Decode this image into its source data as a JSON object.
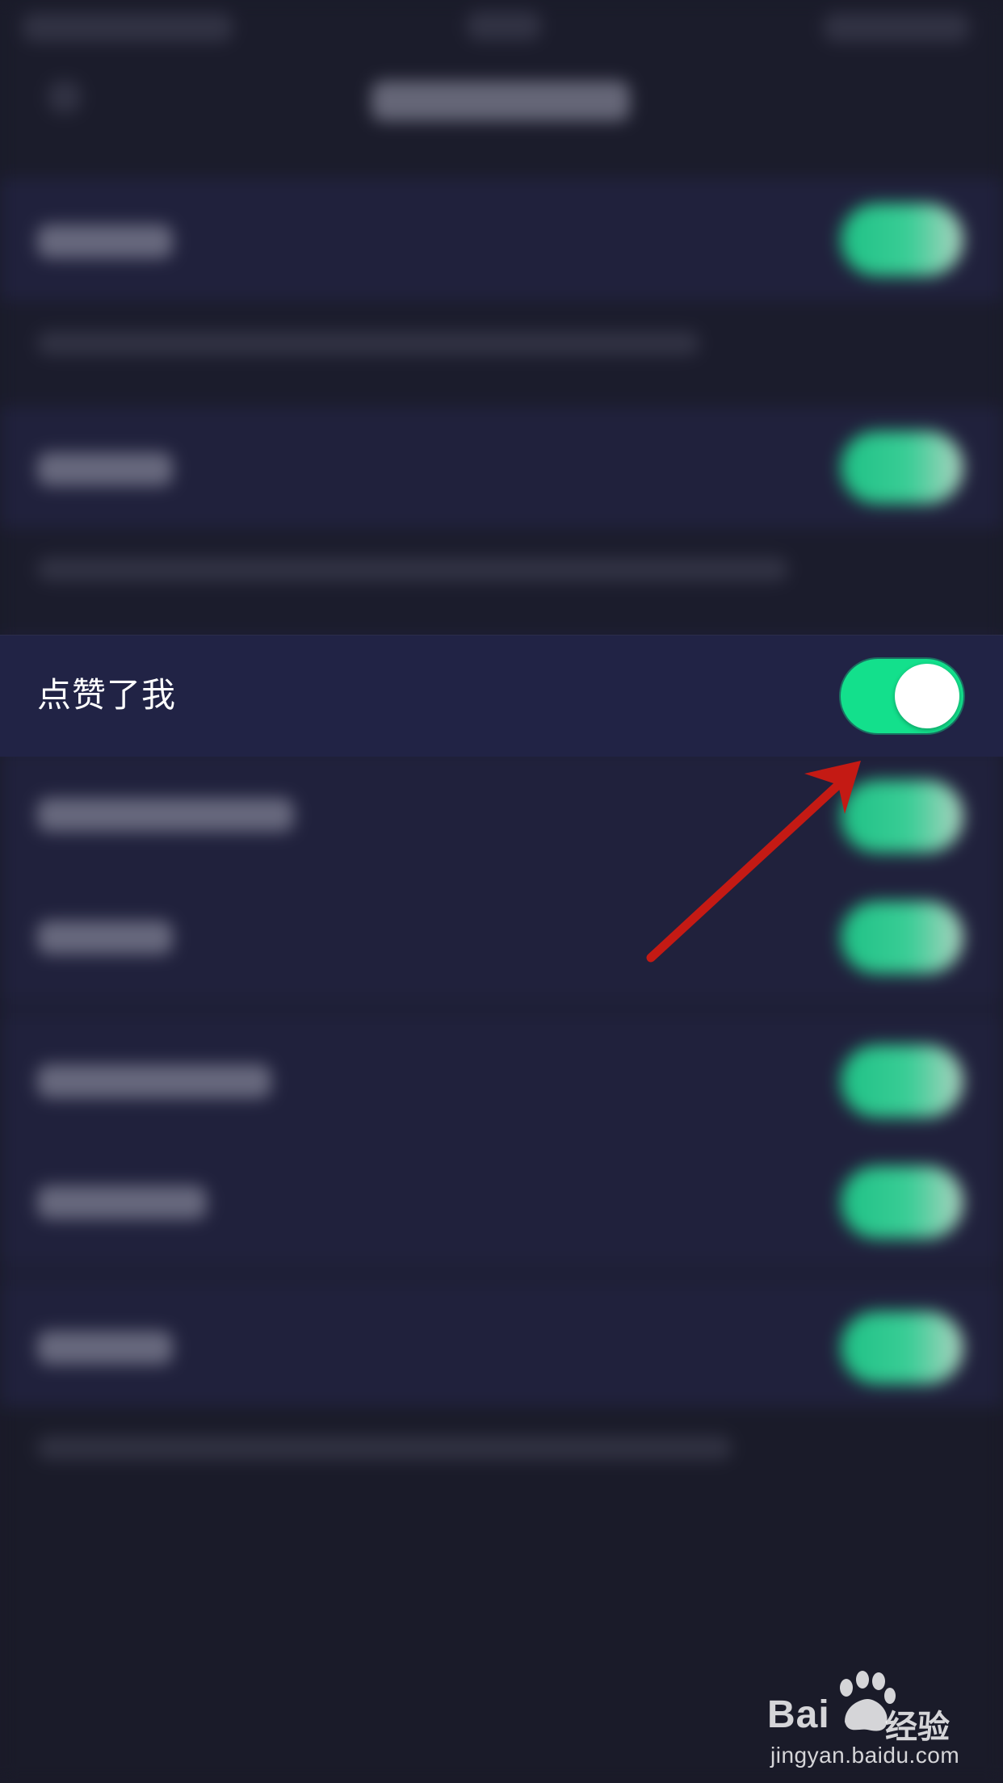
{
  "setting_row": {
    "label": "点赞了我",
    "toggle_on": true
  },
  "colors": {
    "background": "#1a1b29",
    "row_background": "#212345",
    "toggle_on": "#13e08c",
    "annotation_arrow": "#c41a14"
  },
  "watermark": {
    "brand": "Bai",
    "brand_cn": "经验",
    "url": "jingyan.baidu.com"
  }
}
